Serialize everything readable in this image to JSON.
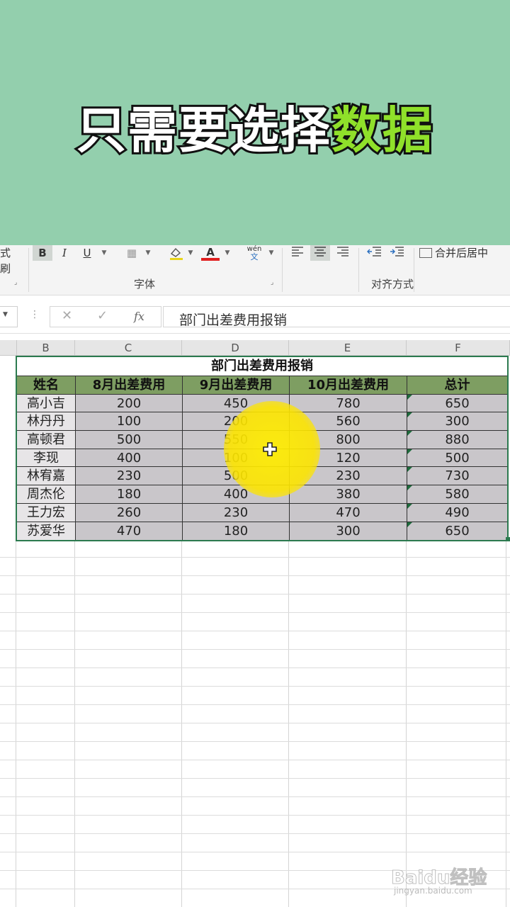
{
  "banner": {
    "title_part1": "只需要选择",
    "title_part2": "数据"
  },
  "ribbon": {
    "format_painter_partial": "式刷",
    "bold": "B",
    "italic": "I",
    "underline": "U",
    "font_color_letter": "A",
    "pinyin_top": "wén",
    "pinyin_bottom": "文",
    "merge_center": "合并后居中",
    "group_font": "字体",
    "group_align": "对齐方式"
  },
  "formula_bar": {
    "cancel": "✕",
    "enter": "✓",
    "fx": "fx",
    "content": "部门出差费用报销"
  },
  "columns": [
    "B",
    "C",
    "D",
    "E",
    "F"
  ],
  "table": {
    "title": "部门出差费用报销",
    "headers": [
      "姓名",
      "8月出差费用",
      "9月出差费用",
      "10月出差费用",
      "总计"
    ],
    "rows": [
      [
        "高小吉",
        "200",
        "450",
        "780",
        "650"
      ],
      [
        "林丹丹",
        "100",
        "200",
        "560",
        "300"
      ],
      [
        "高顿君",
        "500",
        "550",
        "800",
        "880"
      ],
      [
        "李现",
        "400",
        "100",
        "120",
        "500"
      ],
      [
        "林宥嘉",
        "230",
        "500",
        "230",
        "730"
      ],
      [
        "周杰伦",
        "180",
        "400",
        "380",
        "580"
      ],
      [
        "王力宏",
        "260",
        "230",
        "470",
        "490"
      ],
      [
        "苏爱华",
        "470",
        "180",
        "300",
        "650"
      ]
    ]
  },
  "watermark": {
    "main": "Baidu经验",
    "sub": "jingyan.baidu.com"
  }
}
